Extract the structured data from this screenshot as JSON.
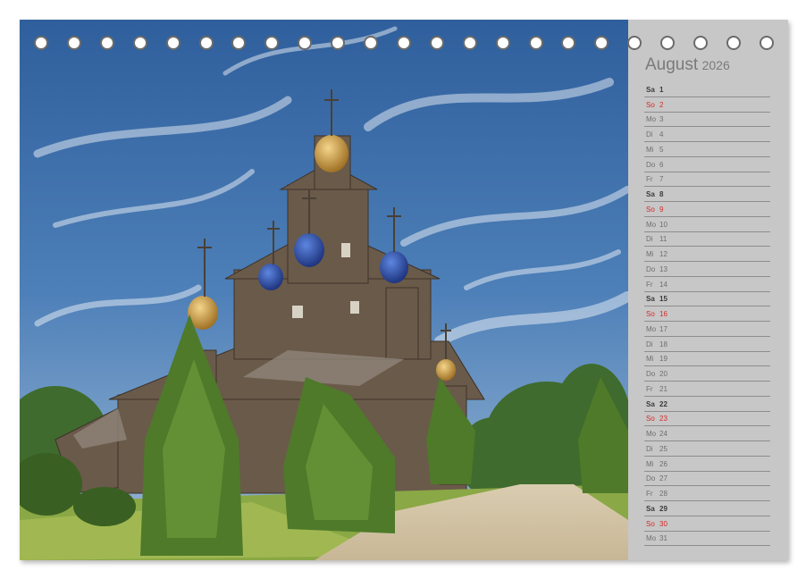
{
  "calendar": {
    "month": "August",
    "year": "2026",
    "days": [
      {
        "wd": "Sa",
        "d": "1",
        "type": "sat"
      },
      {
        "wd": "So",
        "d": "2",
        "type": "sun"
      },
      {
        "wd": "Mo",
        "d": "3",
        "type": "week"
      },
      {
        "wd": "Di",
        "d": "4",
        "type": "week"
      },
      {
        "wd": "Mi",
        "d": "5",
        "type": "week"
      },
      {
        "wd": "Do",
        "d": "6",
        "type": "week"
      },
      {
        "wd": "Fr",
        "d": "7",
        "type": "week"
      },
      {
        "wd": "Sa",
        "d": "8",
        "type": "sat"
      },
      {
        "wd": "So",
        "d": "9",
        "type": "sun"
      },
      {
        "wd": "Mo",
        "d": "10",
        "type": "week"
      },
      {
        "wd": "Di",
        "d": "11",
        "type": "week"
      },
      {
        "wd": "Mi",
        "d": "12",
        "type": "week"
      },
      {
        "wd": "Do",
        "d": "13",
        "type": "week"
      },
      {
        "wd": "Fr",
        "d": "14",
        "type": "week"
      },
      {
        "wd": "Sa",
        "d": "15",
        "type": "sat"
      },
      {
        "wd": "So",
        "d": "16",
        "type": "sun"
      },
      {
        "wd": "Mo",
        "d": "17",
        "type": "week"
      },
      {
        "wd": "Di",
        "d": "18",
        "type": "week"
      },
      {
        "wd": "Mi",
        "d": "19",
        "type": "week"
      },
      {
        "wd": "Do",
        "d": "20",
        "type": "week"
      },
      {
        "wd": "Fr",
        "d": "21",
        "type": "week"
      },
      {
        "wd": "Sa",
        "d": "22",
        "type": "sat"
      },
      {
        "wd": "So",
        "d": "23",
        "type": "sun"
      },
      {
        "wd": "Mo",
        "d": "24",
        "type": "week"
      },
      {
        "wd": "Di",
        "d": "25",
        "type": "week"
      },
      {
        "wd": "Mi",
        "d": "26",
        "type": "week"
      },
      {
        "wd": "Do",
        "d": "27",
        "type": "week"
      },
      {
        "wd": "Fr",
        "d": "28",
        "type": "week"
      },
      {
        "wd": "Sa",
        "d": "29",
        "type": "sat"
      },
      {
        "wd": "So",
        "d": "30",
        "type": "sun"
      },
      {
        "wd": "Mo",
        "d": "31",
        "type": "week"
      }
    ]
  },
  "colors": {
    "sunday": "#d42a2a",
    "saturday": "#3a3a3a",
    "sidebar": "#c7c7c7"
  },
  "photo": {
    "icon": "wooden-church-photo"
  },
  "binding": {
    "hole_count": 23
  }
}
